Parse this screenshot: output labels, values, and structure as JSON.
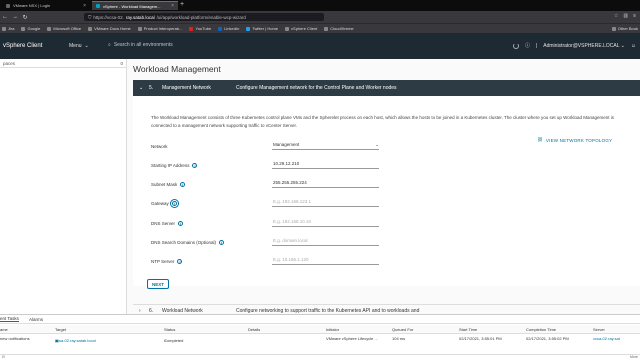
{
  "browser": {
    "tabs": [
      {
        "title": "VMware NSX | Login",
        "active": false
      },
      {
        "title": "vSphere - Workload Managem...",
        "active": true
      }
    ],
    "url_prefix": "https://vcsa-02.",
    "url_host": "ray.satab.local",
    "url_path": "/ui/app/workload-platform/enable-wcp-wizard",
    "bookmarks": [
      "Jira",
      "Google",
      "Microsoft Office",
      "VMware Docs Home",
      "Product Interoperab...",
      "YouTube",
      "LinkedIn",
      "Twitter | Home",
      "vSphere Client",
      "CloudXtreme"
    ],
    "other_bookmarks": "Other Book"
  },
  "header": {
    "brand": "vSphere Client",
    "menu": "Menu",
    "search_placeholder": "Search in all environments",
    "user": "Administrator@VSPHERE.LOCAL"
  },
  "left_panel": {
    "title": "paces",
    "count": "0"
  },
  "page": {
    "title": "Workload Management"
  },
  "step5": {
    "number": "5.",
    "name": "Management Network",
    "summary": "Configure Management network for the Control Plane and Worker nodes"
  },
  "description": "The Workload Management consists of three Kubernetes control plane VMs and the Spherelet process on each host, which allows the hosts to be joined in a Kubernetes cluster. The cluster where you set up Workload Management is connected to a management network supporting traffic to vCenter Server.",
  "view_topology": "VIEW NETWORK TOPOLOGY",
  "form": {
    "network_label": "Network",
    "network_value": "Management",
    "start_ip_label": "Starting IP Address",
    "start_ip_value": "10.29.12.210",
    "subnet_label": "Subnet Mask",
    "subnet_value": "255.255.255.224",
    "gateway_label": "Gateway",
    "gateway_placeholder": "E.g. 192.168.123.1",
    "dns_label": "DNS Server",
    "dns_placeholder": "E.g. 192.168.10.10",
    "dns_search_label": "DNS Search Domains (Optional)",
    "dns_search_placeholder": "E.g. domain.local",
    "ntp_label": "NTP Server",
    "ntp_placeholder": "E.g. 10.166.1.120"
  },
  "next_button": "NEXT",
  "step6": {
    "number": "6.",
    "name": "Workload Network",
    "summary": "Configure networking to support traffic to the Kubernetes API and to workloads and"
  },
  "tasks": {
    "tabs": [
      "ent Tasks",
      "Alarms"
    ],
    "columns": [
      "ame",
      "Target",
      "Status",
      "Details",
      "Initiator",
      "Queued For",
      "Start Time",
      "Completion Time",
      "Server"
    ],
    "row": [
      "new notifications",
      "vcsa-02.ray.satab.local",
      "Completed",
      "",
      "VMware vSphere Lifecycle ...",
      "104 ms",
      "02/17/2021, 3:55:01 PM",
      "02/17/2021, 3:55:02 PM",
      "vcsa-02.ray.sat"
    ]
  },
  "footer": {
    "more": "More"
  }
}
